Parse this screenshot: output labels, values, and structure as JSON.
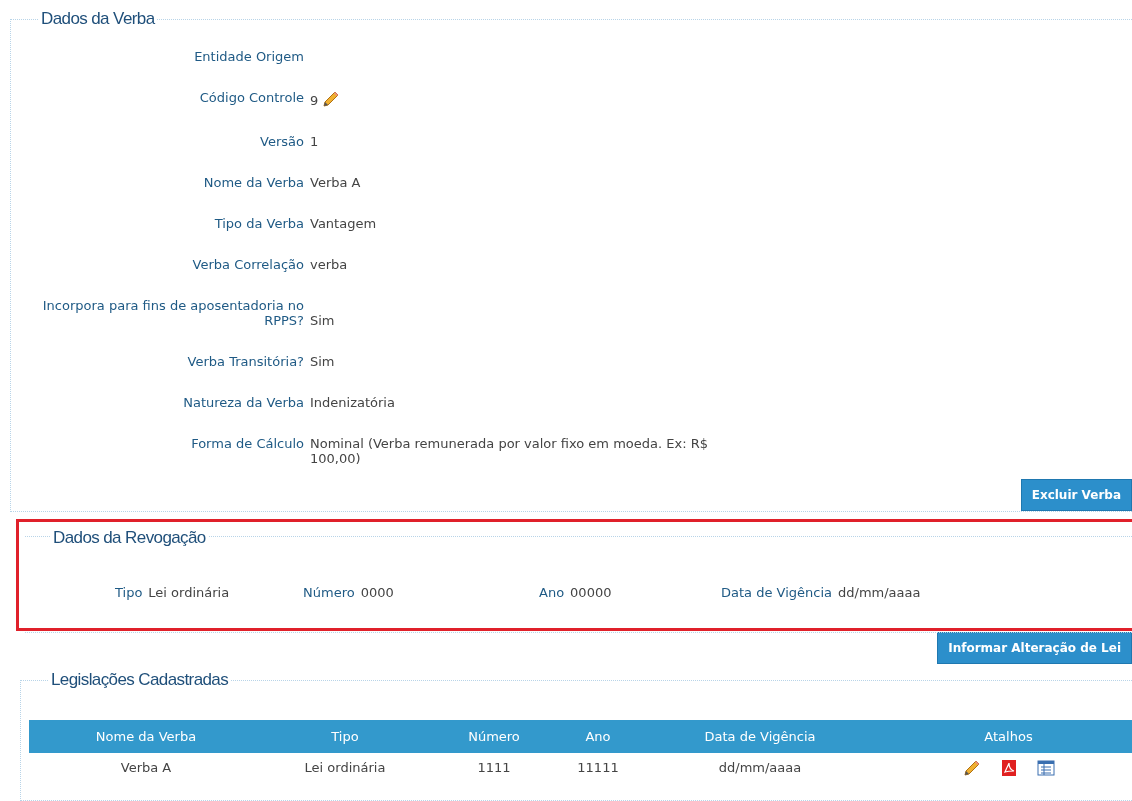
{
  "verba": {
    "title": "Dados da Verba",
    "fields": [
      {
        "kind": "text",
        "label": "Entidade Origem"
      },
      {
        "kind": "editable",
        "label": "Código Controle",
        "value": "9"
      },
      {
        "kind": "text",
        "label": "Versão",
        "value": "1"
      },
      {
        "kind": "text",
        "label": "Nome da Verba",
        "value": "Verba A"
      },
      {
        "kind": "text",
        "label": "Tipo da Verba",
        "value": "Vantagem"
      },
      {
        "kind": "text",
        "label": "Verba Correlação",
        "value": "verba"
      },
      {
        "kind": "text",
        "label": "Incorpora para fins de aposentadoria no RPPS?",
        "value": "Sim"
      },
      {
        "kind": "text",
        "label": "Verba Transitória?",
        "value": "Sim"
      },
      {
        "kind": "text",
        "label": "Natureza da Verba",
        "value": "Indenizatória"
      },
      {
        "kind": "text",
        "label": "Forma de Cálculo",
        "value": "Nominal (Verba remunerada por valor fixo em moeda. Ex: R$ 100,00)"
      }
    ],
    "button": "Excluir Verba"
  },
  "revogacao": {
    "title": "Dados da Revogação",
    "fields": [
      {
        "label": "Tipo",
        "value": "Lei ordinária"
      },
      {
        "label": "Número",
        "value": "0000"
      },
      {
        "label": "Ano",
        "value": "00000"
      },
      {
        "label": "Data de Vigência",
        "value": "dd/mm/aaaa"
      }
    ],
    "button": "Informar Alteração de Lei"
  },
  "legislacoes": {
    "title": "Legislações Cadastradas",
    "columns": [
      "Nome da Verba",
      "Tipo",
      "Número",
      "Ano",
      "Data de Vigência",
      "Atalhos"
    ],
    "rows": [
      {
        "cells": [
          "Verba A",
          "Lei ordinária",
          "1111",
          "11111",
          "dd/mm/aaaa"
        ]
      }
    ]
  }
}
